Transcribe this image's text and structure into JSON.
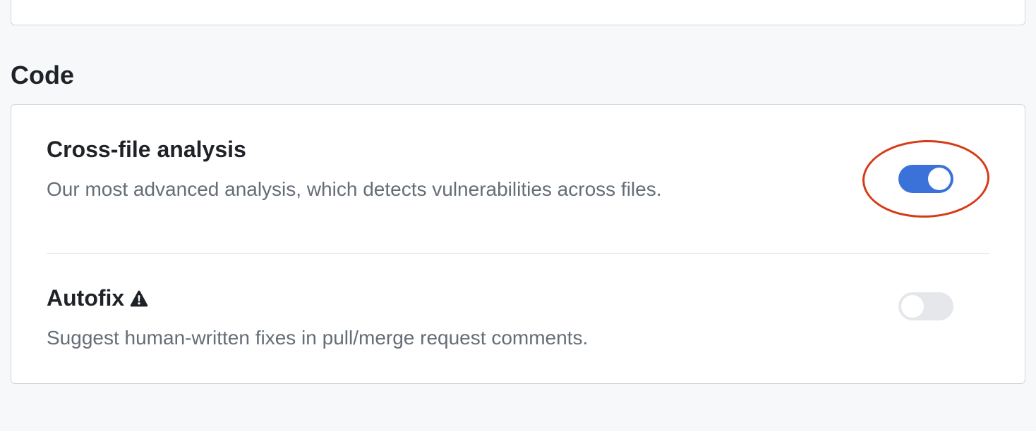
{
  "section": {
    "heading": "Code",
    "items": [
      {
        "title": "Cross-file analysis",
        "description": "Our most advanced analysis, which detects vulnerabilities across files.",
        "toggle_on": true,
        "highlighted": true,
        "warning_icon": false
      },
      {
        "title": "Autofix",
        "description": "Suggest human-written fixes in pull/merge request comments.",
        "toggle_on": false,
        "highlighted": false,
        "warning_icon": true
      }
    ]
  }
}
